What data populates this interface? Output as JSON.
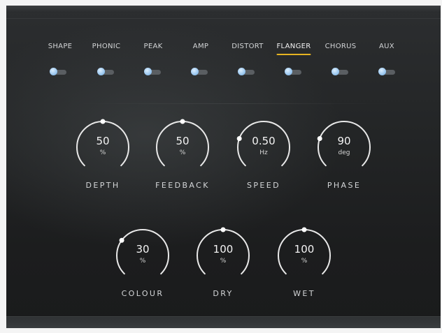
{
  "accent_color": "#e6b422",
  "tabs": [
    {
      "label": "SHAPE",
      "active": false
    },
    {
      "label": "PHONIC",
      "active": false
    },
    {
      "label": "PEAK",
      "active": false
    },
    {
      "label": "AMP",
      "active": false
    },
    {
      "label": "DISTORT",
      "active": false
    },
    {
      "label": "FLANGER",
      "active": true
    },
    {
      "label": "CHORUS",
      "active": false
    },
    {
      "label": "AUX",
      "active": false
    }
  ],
  "toggles": [
    {
      "name": "shape",
      "on": false
    },
    {
      "name": "phonic",
      "on": false
    },
    {
      "name": "peak",
      "on": false
    },
    {
      "name": "amp",
      "on": false
    },
    {
      "name": "distort",
      "on": false
    },
    {
      "name": "flanger",
      "on": false
    },
    {
      "name": "chorus",
      "on": false
    },
    {
      "name": "aux",
      "on": false
    }
  ],
  "knobs": {
    "depth": {
      "label": "DEPTH",
      "value": "50",
      "unit": "%",
      "position": 0.5
    },
    "feedback": {
      "label": "FEEDBACK",
      "value": "50",
      "unit": "%",
      "position": 0.5
    },
    "speed": {
      "label": "SPEED",
      "value": "0.50",
      "unit": "Hz",
      "position": 0.24
    },
    "phase": {
      "label": "PHASE",
      "value": "90",
      "unit": "deg",
      "position": 0.24
    },
    "colour": {
      "label": "COLOUR",
      "value": "30",
      "unit": "%",
      "position": 0.3
    },
    "dry": {
      "label": "DRY",
      "value": "100",
      "unit": "%",
      "position": 0.5
    },
    "wet": {
      "label": "WET",
      "value": "100",
      "unit": "%",
      "position": 0.5
    }
  }
}
